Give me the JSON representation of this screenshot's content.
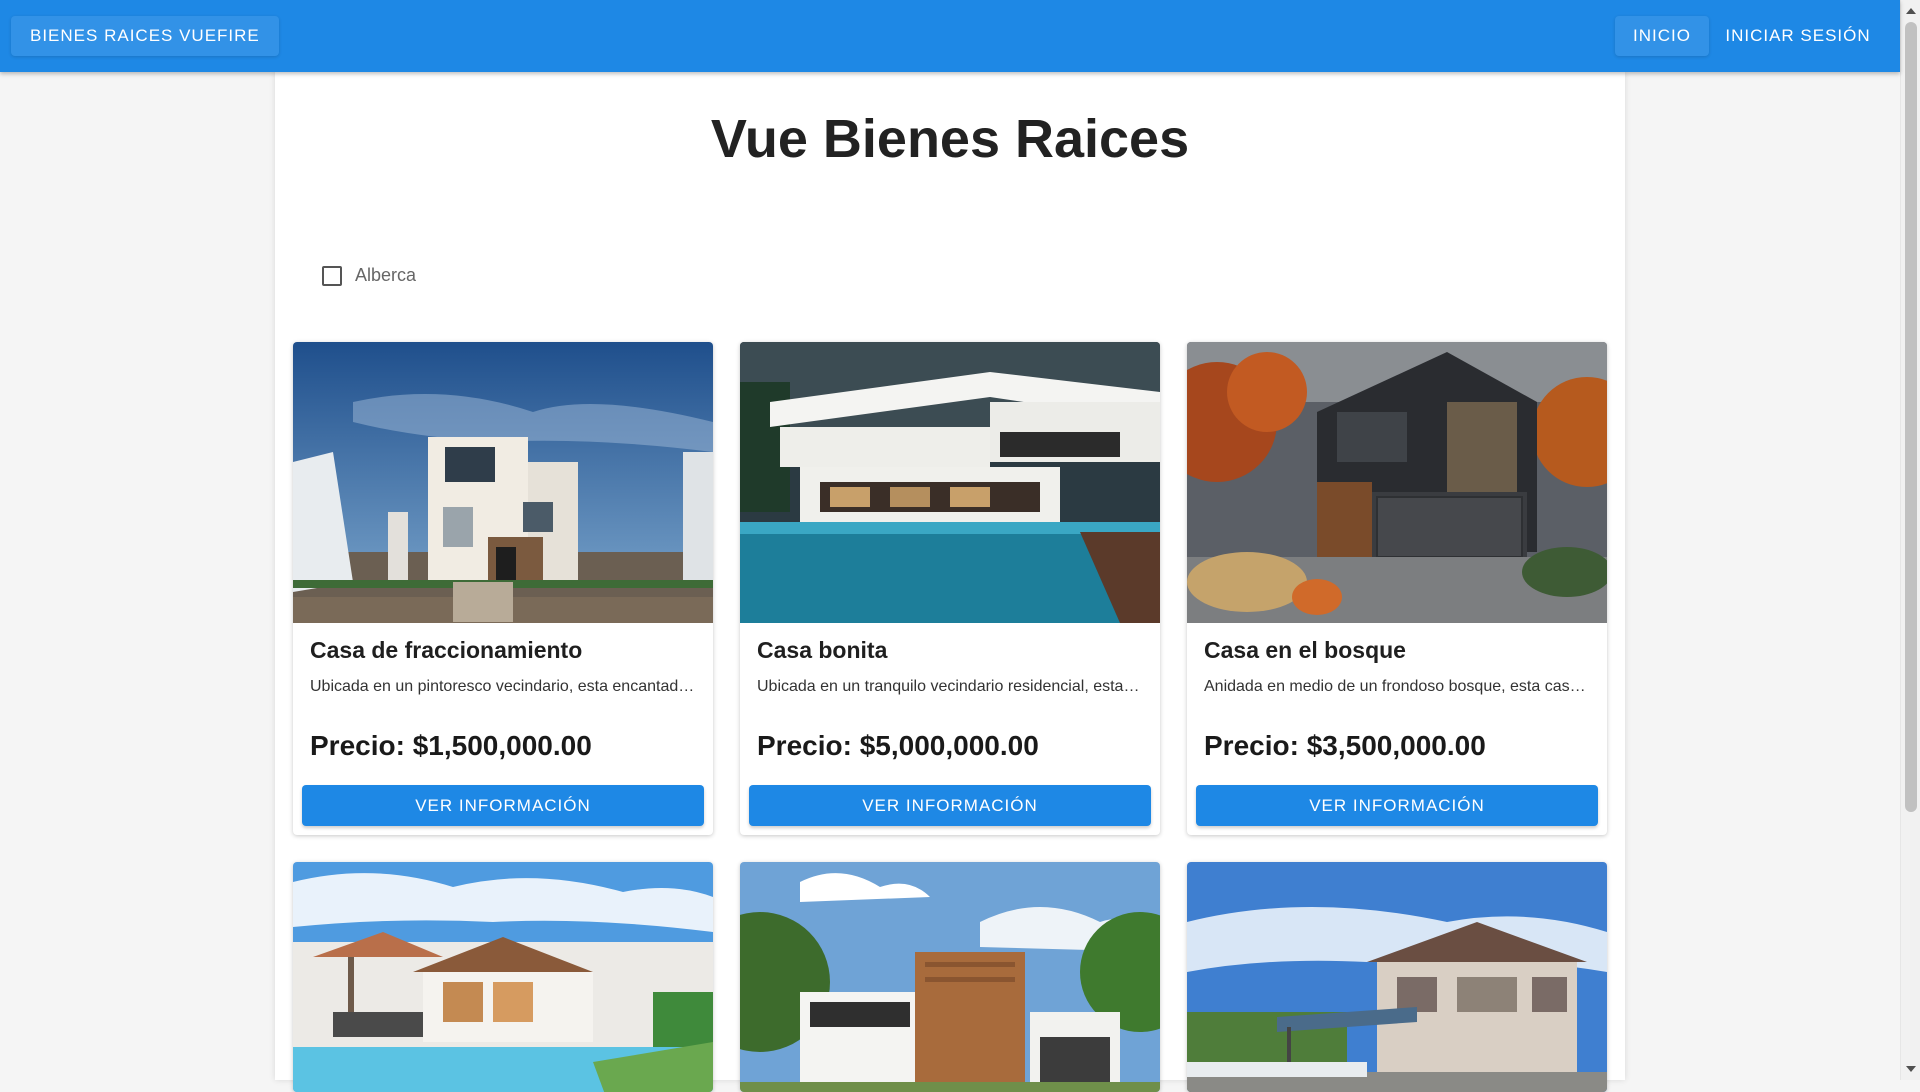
{
  "appbar": {
    "brand": "BIENES RAICES VUEFIRE",
    "nav_inicio": "INICIO",
    "nav_login": "INICIAR SESIÓN",
    "color": "#1e88e5"
  },
  "main": {
    "title": "Vue Bienes Raices",
    "filter_label": "Alberca",
    "filter_checked": false
  },
  "properties": [
    {
      "title": "Casa de fraccionamiento",
      "description": "Ubicada en un pintoresco vecindario, esta encantadora casa de fraccionamiento",
      "price": "Precio: $1,500,000.00",
      "button": "VER INFORMACIÓN"
    },
    {
      "title": "Casa bonita",
      "description": "Ubicada en un tranquilo vecindario residencial, esta hermosa casa",
      "price": "Precio: $5,000,000.00",
      "button": "VER INFORMACIÓN"
    },
    {
      "title": "Casa en el bosque",
      "description": "Anidada en medio de un frondoso bosque, esta casa de ensueño",
      "price": "Precio: $3,500,000.00",
      "button": "VER INFORMACIÓN"
    },
    {
      "title": "",
      "description": "",
      "price": "",
      "button": ""
    },
    {
      "title": "",
      "description": "",
      "price": "",
      "button": ""
    },
    {
      "title": "",
      "description": "",
      "price": "",
      "button": ""
    }
  ]
}
